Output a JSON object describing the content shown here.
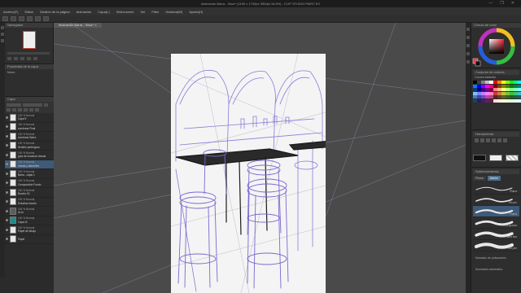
{
  "window": {
    "title": "Ilustración Barra - Visor* (1100 x 1700px 350dpi 16.6%) - CLIP STUDIO PAINT EX",
    "controls": [
      "—",
      "❐",
      "✕"
    ]
  },
  "menu": [
    "Archivo(F)",
    "Editar",
    "Gestión de la página",
    "Animación",
    "Capa(L)",
    "Selecciones",
    "Ver",
    "Filtro",
    "Ventana(W)",
    "Ayuda(H)"
  ],
  "canvas": {
    "tab": "Ilustración Barra - Visor* ×"
  },
  "left": {
    "navigator_label": "Navegador",
    "properties_label": "Propiedad de la capa",
    "properties_sub": "Marco",
    "layer_label": "Capa",
    "layers": [
      {
        "mode": "100 % Normal",
        "name": "Capa 9",
        "thumb": "white"
      },
      {
        "mode": "100 % Normal",
        "name": "sombrear Final",
        "thumb": "white"
      },
      {
        "mode": "100 % Normal",
        "name": "sombrear Barra",
        "thumb": "white"
      },
      {
        "mode": "100 % Normal",
        "name": "Sentido pedregoso",
        "thumb": "white"
      },
      {
        "mode": "100 % Normal",
        "name": "guía de cruzaron mesas",
        "thumb": "white"
      },
      {
        "mode": "100 % Normal",
        "name": "mesas y taburetes",
        "thumb": "white",
        "active": true
      },
      {
        "mode": "100 % Normal",
        "name": "Barra - cajas 1",
        "thumb": "white"
      },
      {
        "mode": "100 % Normal",
        "name": "Composición Fondo",
        "thumb": "white"
      },
      {
        "mode": "100 % Normal",
        "name": "Boceto 02",
        "thumb": "white"
      },
      {
        "mode": "100 % Normal",
        "name": "Estudios boceto",
        "thumb": "white"
      },
      {
        "mode": "100 % Normal",
        "name": "Ilu fo",
        "thumb": "folder"
      },
      {
        "mode": "100 % Normal",
        "name": "Capa 11",
        "thumb": "teal"
      },
      {
        "mode": "100 % Normal",
        "name": "Papel de dibujo",
        "thumb": "white"
      },
      {
        "mode": "",
        "name": "Papel",
        "thumb": "white"
      }
    ]
  },
  "right": {
    "color_label": "Círculo de color",
    "palette_label": "Conjunto de colores",
    "palette_set": "Colores estándar",
    "material_label": "Herramienta",
    "brush_panel_label": "Subherramienta",
    "brush_tabs": [
      "Pluma",
      "Marker"
    ],
    "brushes": [
      {
        "name": "Pluma"
      },
      {
        "name": "Fill pen"
      },
      {
        "name": "Pluma",
        "selected": true
      },
      {
        "name": "Pluma gruesa"
      },
      {
        "name": "Pluma fina"
      },
      {
        "name": "Dot pen"
      }
    ],
    "brush_footer": "Marcador de pulsaciones",
    "brush_footer2": "Suavizado automático",
    "main_color": "#e8384f",
    "swatch_colors": [
      "#000000",
      "#404040",
      "#808080",
      "#c0c0c0",
      "#ffffff",
      "#ff0000",
      "#ff8000",
      "#ffff00",
      "#80ff00",
      "#00ff00",
      "#00ff80",
      "#00ffff",
      "#0080ff",
      "#0000ff",
      "#8000ff",
      "#ff00ff",
      "#ff0080",
      "#800000",
      "#804000",
      "#808000",
      "#408000",
      "#008000",
      "#008040",
      "#008080",
      "#004080",
      "#000080",
      "#400080",
      "#800080",
      "#800040",
      "#ff8080",
      "#ffc080",
      "#ffff80",
      "#c0ff80",
      "#80ff80",
      "#80ffc0",
      "#80ffff",
      "#80c0ff",
      "#8080ff",
      "#c080ff",
      "#ff80ff",
      "#ff80c0",
      "#c04040",
      "#c08040",
      "#c0c040",
      "#80c040",
      "#40c040",
      "#40c080",
      "#40c0c0",
      "#4080c0",
      "#4040c0",
      "#8040c0",
      "#c040c0",
      "#c04080",
      "#602020",
      "#604020",
      "#606020",
      "#406020",
      "#206020",
      "#206040",
      "#206060",
      "#204060",
      "#202060",
      "#402060",
      "#602060",
      "#602040",
      "#ffe0e0",
      "#fff0e0",
      "#ffffe0",
      "#f0ffe0",
      "#e0ffe0",
      "#e0fff0",
      "#e0ffff"
    ]
  }
}
